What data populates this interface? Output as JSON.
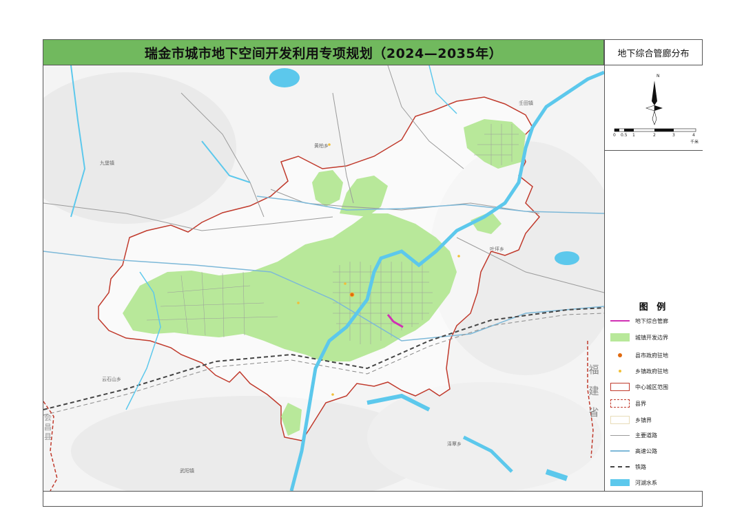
{
  "header": {
    "title": "瑞金市城市地下空间开发利用专项规划（2024—2035年）",
    "map_subject": "地下综合管廊分布"
  },
  "scale_bar": {
    "ticks": [
      "0",
      "0.5",
      "1",
      "2",
      "3",
      "4"
    ],
    "unit": "千米",
    "north": "N"
  },
  "legend": {
    "title": "图 例",
    "items": [
      {
        "label": "地下综合管廊",
        "symbol": "utility-tunnel",
        "color": "#d12fb4"
      },
      {
        "label": "城镇开发边界",
        "symbol": "urban-boundary",
        "color": "#b8e89a"
      },
      {
        "label": "县市政府驻地",
        "symbol": "county-seat",
        "color": "#e06a10"
      },
      {
        "label": "乡镇政府驻地",
        "symbol": "township-seat",
        "color": "#f2c038"
      },
      {
        "label": "中心城区范围",
        "symbol": "central-area",
        "color": "#c0392b"
      },
      {
        "label": "县界",
        "symbol": "county-boundary",
        "color": "#c0392b"
      },
      {
        "label": "乡镇界",
        "symbol": "township-boundary",
        "color": "#f0e6c8"
      },
      {
        "label": "主要道路",
        "symbol": "main-road",
        "color": "#9a9a9a"
      },
      {
        "label": "高速公路",
        "symbol": "expressway",
        "color": "#7cb8d8"
      },
      {
        "label": "铁路",
        "symbol": "railway",
        "color": "#444444"
      },
      {
        "label": "河湖水系",
        "symbol": "water",
        "color": "#5cc8ec"
      }
    ]
  },
  "map": {
    "province_label": "福建省",
    "county_label": "会昌县",
    "places": [
      "壬田镇",
      "九堡镇",
      "黄柏乡",
      "叶坪乡",
      "云石山乡",
      "泽覃乡",
      "武阳镇"
    ]
  }
}
